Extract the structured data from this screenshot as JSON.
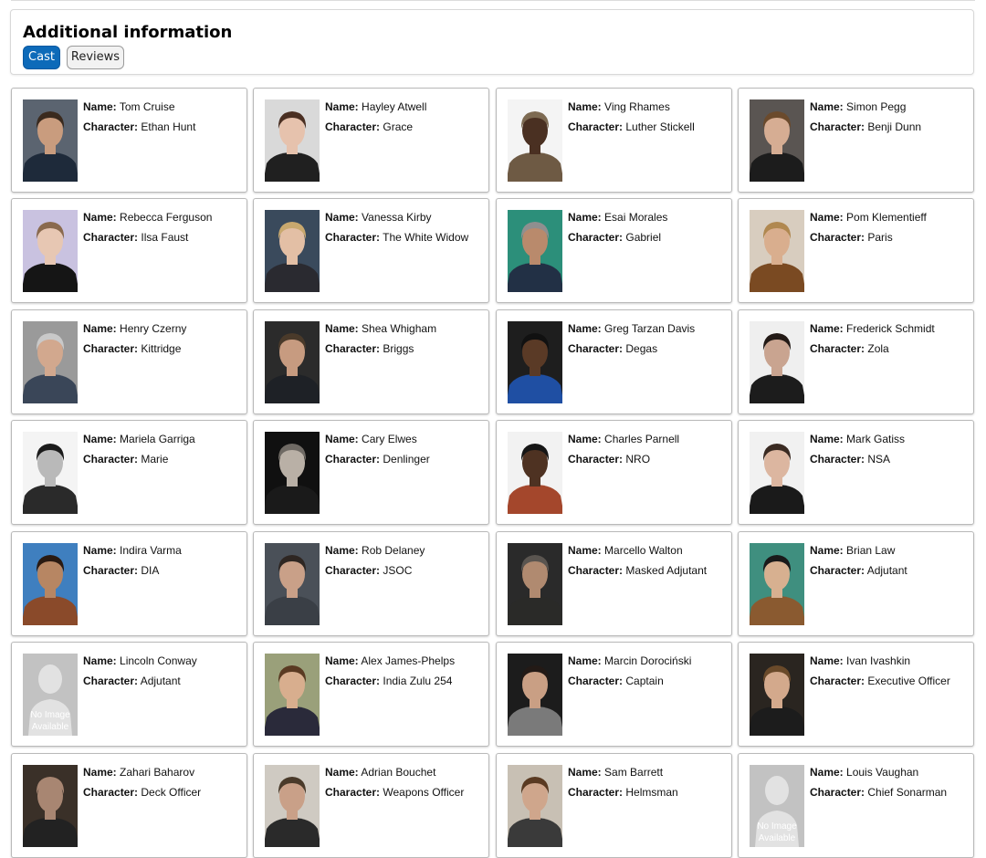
{
  "section": {
    "title": "Additional information",
    "tabs": [
      {
        "label": "Cast",
        "active": true
      },
      {
        "label": "Reviews",
        "active": false
      }
    ]
  },
  "labels": {
    "name": "Name:",
    "character": "Character:"
  },
  "no_image": {
    "line1": "No Image",
    "line2": "Available"
  },
  "cast": [
    {
      "name": "Tom Cruise",
      "character": "Ethan Hunt",
      "bg": "#5b6470",
      "skin": "#c99c7e",
      "hair": "#3a2a1e",
      "shirt": "#1e2a3a"
    },
    {
      "name": "Hayley Atwell",
      "character": "Grace",
      "bg": "#d9d9d9",
      "skin": "#e6c2ad",
      "hair": "#4a2f22",
      "shirt": "#202020"
    },
    {
      "name": "Ving Rhames",
      "character": "Luther Stickell",
      "bg": "#f4f4f4",
      "skin": "#4a3022",
      "hair": "#7d6a52",
      "shirt": "#6e5a44"
    },
    {
      "name": "Simon Pegg",
      "character": "Benji Dunn",
      "bg": "#5a5552",
      "skin": "#d6ad93",
      "hair": "#6b4a2c",
      "shirt": "#1c1c1c"
    },
    {
      "name": "Rebecca Ferguson",
      "character": "Ilsa Faust",
      "bg": "#c9c2e0",
      "skin": "#e7c7b3",
      "hair": "#8a6a4e",
      "shirt": "#151515"
    },
    {
      "name": "Vanessa Kirby",
      "character": "The White Widow",
      "bg": "#3a4a5c",
      "skin": "#e3bfa5",
      "hair": "#c8a86e",
      "shirt": "#2a2a30"
    },
    {
      "name": "Esai Morales",
      "character": "Gabriel",
      "bg": "#2c8f7a",
      "skin": "#b98a6c",
      "hair": "#8f8f8f",
      "shirt": "#223045"
    },
    {
      "name": "Pom Klementieff",
      "character": "Paris",
      "bg": "#d8cdbf",
      "skin": "#d9ae8e",
      "hair": "#b08850",
      "shirt": "#7a4a22"
    },
    {
      "name": "Henry Czerny",
      "character": "Kittridge",
      "bg": "#9a9a9a",
      "skin": "#d2a88e",
      "hair": "#c9c9c9",
      "shirt": "#3a4658"
    },
    {
      "name": "Shea Whigham",
      "character": "Briggs",
      "bg": "#2b2b2b",
      "skin": "#c79b80",
      "hair": "#4a3a2a",
      "shirt": "#1e2126"
    },
    {
      "name": "Greg Tarzan Davis",
      "character": "Degas",
      "bg": "#1e1e1e",
      "skin": "#5a3a26",
      "hair": "#111111",
      "shirt": "#1f4fa3"
    },
    {
      "name": "Frederick Schmidt",
      "character": "Zola",
      "bg": "#efefef",
      "skin": "#c9a490",
      "hair": "#231a16",
      "shirt": "#1c1c1c"
    },
    {
      "name": "Mariela Garriga",
      "character": "Marie",
      "bg": "#f4f4f4",
      "skin": "#b9b9b9",
      "hair": "#1b1b1b",
      "shirt": "#2a2a2a"
    },
    {
      "name": "Cary Elwes",
      "character": "Denlinger",
      "bg": "#101010",
      "skin": "#b9b0a6",
      "hair": "#6f6a64",
      "shirt": "#1a1a1a"
    },
    {
      "name": "Charles Parnell",
      "character": "NRO",
      "bg": "#f2f2f2",
      "skin": "#4e3222",
      "hair": "#161616",
      "shirt": "#a4472c"
    },
    {
      "name": "Mark Gatiss",
      "character": "NSA",
      "bg": "#f1f1f1",
      "skin": "#dcb6a0",
      "hair": "#3a2a22",
      "shirt": "#1a1a1a"
    },
    {
      "name": "Indira Varma",
      "character": "DIA",
      "bg": "#3f7fbf",
      "skin": "#b78663",
      "hair": "#2a1a12",
      "shirt": "#8a4a2a"
    },
    {
      "name": "Rob Delaney",
      "character": "JSOC",
      "bg": "#4a5058",
      "skin": "#c9a088",
      "hair": "#2e2622",
      "shirt": "#3a3f46"
    },
    {
      "name": "Marcello Walton",
      "character": "Masked Adjutant",
      "bg": "#2a2a2a",
      "skin": "#b08a70",
      "hair": "#5a5550",
      "shirt": "#2a2a28"
    },
    {
      "name": "Brian Law",
      "character": "Adjutant",
      "bg": "#3f8f7f",
      "skin": "#d7b090",
      "hair": "#1a1a1a",
      "shirt": "#8a5a30"
    },
    {
      "name": "Lincoln Conway",
      "character": "Adjutant",
      "noimage": true
    },
    {
      "name": "Alex James-Phelps",
      "character": "India Zulu 254",
      "bg": "#9aa07a",
      "skin": "#d8ae8e",
      "hair": "#5a3a22",
      "shirt": "#2a2a3a"
    },
    {
      "name": "Marcin Dorociński",
      "character": "Captain",
      "bg": "#1c1c1c",
      "skin": "#c99f84",
      "hair": "#231a16",
      "shirt": "#7a7a7a"
    },
    {
      "name": "Ivan Ivashkin",
      "character": "Executive Officer",
      "bg": "#2a2520",
      "skin": "#d3a98c",
      "hair": "#6a4a2a",
      "shirt": "#1c1c1c"
    },
    {
      "name": "Zahari Baharov",
      "character": "Deck Officer",
      "bg": "#3a3028",
      "skin": "#a88672",
      "hair": "#a88672",
      "shirt": "#222222"
    },
    {
      "name": "Adrian Bouchet",
      "character": "Weapons Officer",
      "bg": "#cfcac2",
      "skin": "#c9a088",
      "hair": "#4a3a2a",
      "shirt": "#2a2a2a"
    },
    {
      "name": "Sam Barrett",
      "character": "Helmsman",
      "bg": "#c8c0b4",
      "skin": "#cfa68c",
      "hair": "#5a3a22",
      "shirt": "#3a3a3a"
    },
    {
      "name": "Louis Vaughan",
      "character": "Chief Sonarman",
      "noimage": true
    }
  ]
}
